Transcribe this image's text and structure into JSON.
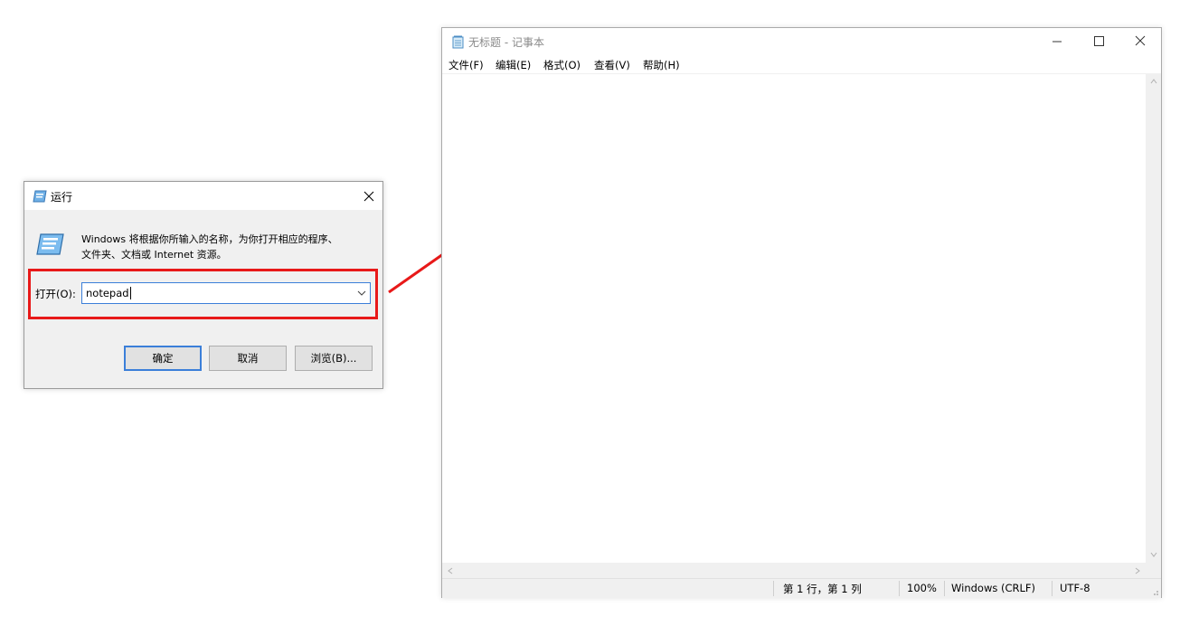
{
  "run_dialog": {
    "title": "运行",
    "description_line1": "Windows 将根据你所输入的名称，为你打开相应的程序、",
    "description_line2": "文件夹、文档或 Internet 资源。",
    "open_label": "打开(O):",
    "input_value": "notepad",
    "buttons": {
      "ok": "确定",
      "cancel": "取消",
      "browse": "浏览(B)..."
    },
    "highlight_color": "#e81919"
  },
  "notepad": {
    "title": "无标题 - 记事本",
    "menu": [
      "文件(F)",
      "编辑(E)",
      "格式(O)",
      "查看(V)",
      "帮助(H)"
    ],
    "status": {
      "position": "第 1 行，第 1 列",
      "zoom": "100%",
      "line_ending": "Windows (CRLF)",
      "encoding": "UTF-8"
    }
  },
  "colors": {
    "accent": "#3b7fd9",
    "arrow": "#e81919"
  }
}
